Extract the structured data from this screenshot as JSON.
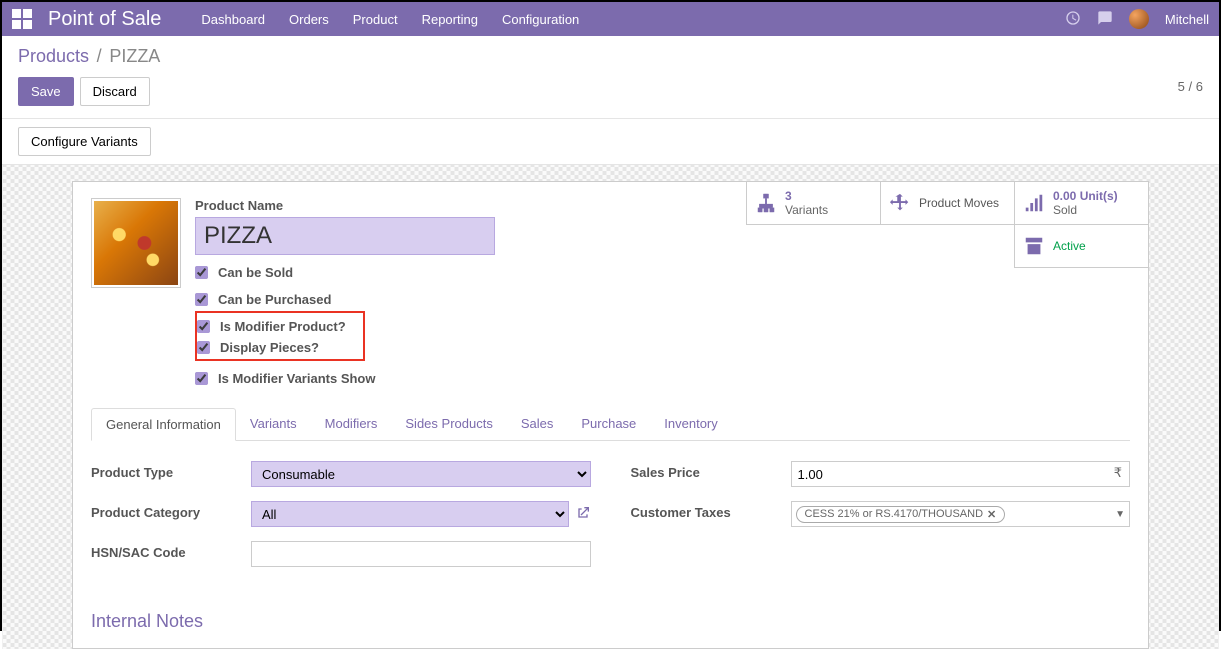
{
  "topbar": {
    "brand": "Point of Sale",
    "menu": [
      "Dashboard",
      "Orders",
      "Product",
      "Reporting",
      "Configuration"
    ],
    "user": "Mitchell"
  },
  "breadcrumb": {
    "parent": "Products",
    "sep": "/",
    "current": "PIZZA"
  },
  "actions": {
    "save": "Save",
    "discard": "Discard",
    "configure_variants": "Configure Variants"
  },
  "pager": {
    "current": "5",
    "sep": "/",
    "total": "6"
  },
  "stats": {
    "variants": {
      "count": "3",
      "label": "Variants"
    },
    "moves": {
      "label": "Product Moves"
    },
    "sold": {
      "value": "0.00 Unit(s)",
      "label": "Sold"
    },
    "active": {
      "label": "Active"
    }
  },
  "product": {
    "name_label": "Product Name",
    "name": "PIZZA",
    "checks": {
      "can_be_sold": "Can be Sold",
      "can_be_purchased": "Can be Purchased",
      "is_modifier": "Is Modifier Product?",
      "display_pieces": "Display Pieces?",
      "modifier_variants_show": "Is Modifier Variants Show"
    }
  },
  "tabs": [
    "General Information",
    "Variants",
    "Modifiers",
    "Sides Products",
    "Sales",
    "Purchase",
    "Inventory"
  ],
  "general": {
    "left": {
      "product_type_label": "Product Type",
      "product_type_value": "Consumable",
      "product_category_label": "Product Category",
      "product_category_value": "All",
      "hsn_label": "HSN/SAC Code",
      "hsn_value": ""
    },
    "right": {
      "sales_price_label": "Sales Price",
      "sales_price_value": "1.00",
      "currency": "₹",
      "customer_taxes_label": "Customer Taxes",
      "tax_tag": "CESS 21% or RS.4170/THOUSAND"
    }
  },
  "internal_notes_heading": "Internal Notes"
}
